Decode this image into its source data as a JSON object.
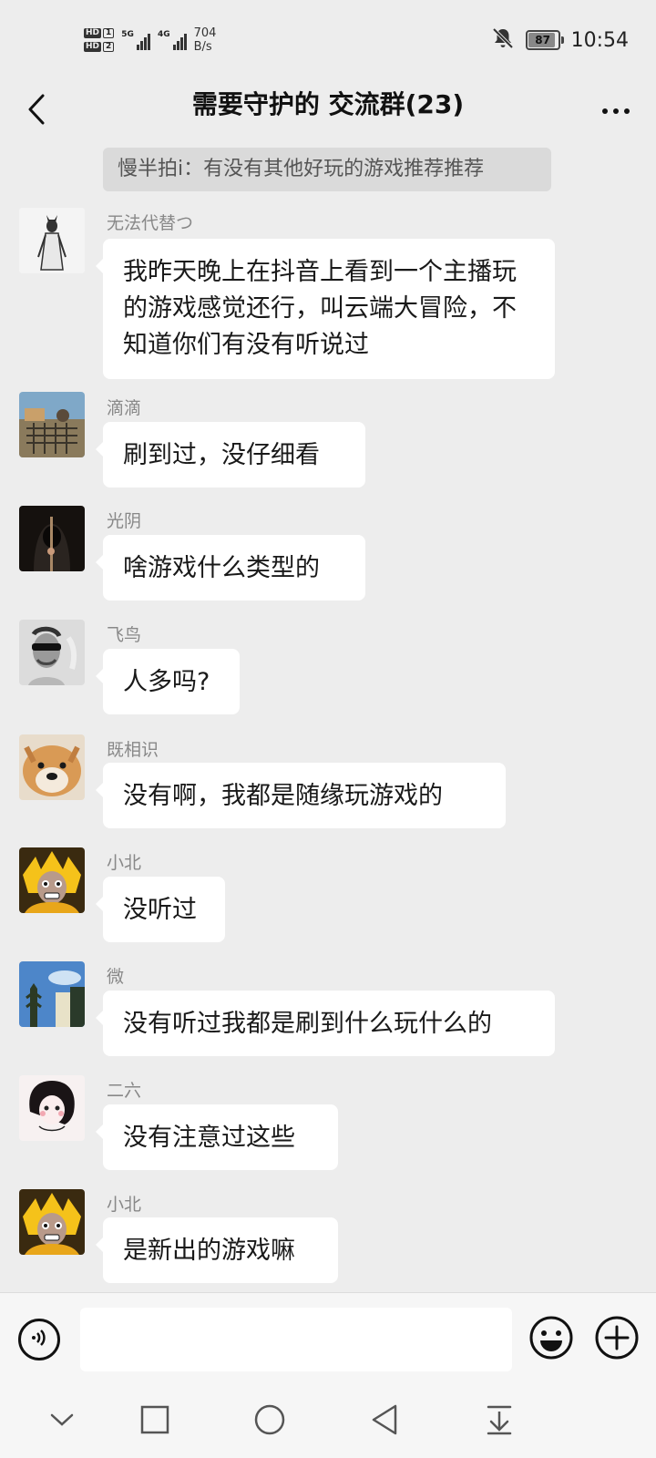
{
  "status_bar": {
    "sim1_label": "HD",
    "sim1_num": "1",
    "sim2_label": "HD",
    "sim2_num": "2",
    "network1": "5G",
    "network2": "4G",
    "speed_value": "704",
    "speed_unit": "B/s",
    "battery": "87",
    "battery_level": 0.87,
    "time": "10:54"
  },
  "header": {
    "title": "需要守护的 交流群(23)"
  },
  "notice": {
    "text": "慢半拍i：有没有其他好玩的游戏推荐推荐"
  },
  "messages": [
    {
      "sender": "无法代替つ",
      "text": "我昨天晚上在抖音上看到一个主播玩的游戏感觉还行，叫云端大冒险，不知道你们有没有听说过"
    },
    {
      "sender": "滴滴",
      "text": "刷到过，没仔细看"
    },
    {
      "sender": "光阴",
      "text": "啥游戏什么类型的"
    },
    {
      "sender": "飞鸟",
      "text": "人多吗?"
    },
    {
      "sender": "既相识",
      "text": "没有啊，我都是随缘玩游戏的"
    },
    {
      "sender": "小北",
      "text": "没听过"
    },
    {
      "sender": "微",
      "text": "没有听过我都是刷到什么玩什么的"
    },
    {
      "sender": "二六",
      "text": "没有注意过这些"
    },
    {
      "sender": "小北",
      "text": "是新出的游戏嘛"
    }
  ],
  "input_bar": {
    "value": ""
  },
  "icons": {
    "back": "chevron-left-icon",
    "more": "more-dots-icon",
    "voice": "voice-icon",
    "emoji": "emoji-icon",
    "plus": "plus-icon",
    "sys_collapse": "chevron-down-icon",
    "sys_recents": "square-icon",
    "sys_home": "circle-icon",
    "sys_back": "triangle-back-icon",
    "sys_notifications": "pull-down-icon"
  },
  "colors": {
    "background": "#ededed",
    "bubble": "#ffffff",
    "notice": "#dadada",
    "sender_name": "#888888"
  }
}
